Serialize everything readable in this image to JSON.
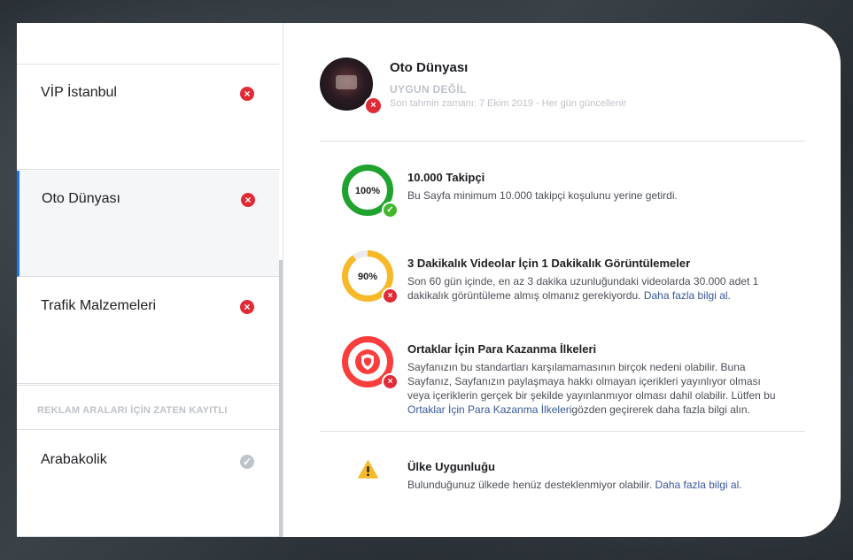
{
  "sidebar": {
    "items": [
      {
        "label": "VİP İstanbul",
        "status": "×"
      },
      {
        "label": "Oto Dünyası",
        "status": "×"
      },
      {
        "label": "Trafik Malzemeleri",
        "status": "×"
      }
    ],
    "section_header": "REKLAM ARALARI İÇİN ZATEN KAYITLI",
    "registered": [
      {
        "label": "Arabakolik",
        "status": "✓"
      }
    ]
  },
  "page": {
    "name": "Oto Dünyası",
    "status": "UYGUN DEĞİL",
    "updated": "Son tahmin zamanı: 7 Ekim 2019 - Her gün güncellenir",
    "badge": "×"
  },
  "criteria": [
    {
      "title": "10.000 Takipçi",
      "desc": "Bu Sayfa minimum 10.000 takipçi koşulunu yerine getirdi.",
      "percent_label": "100%",
      "progress": 1.0,
      "color": "#1fa22e",
      "badge": "✓"
    },
    {
      "title": "3 Dakikalık Videolar İçin 1 Dakikalık Görüntülemeler",
      "desc": "Son 60 gün içinde, en az 3 dakika uzunluğundaki videolarda 30.000 adet 1 dakikalık görüntüleme almış olmanız gerekiyordu.",
      "link": "Daha fazla bilgi al.",
      "percent_label": "90%",
      "progress": 0.9,
      "color": "#f7b928",
      "badge": "×"
    },
    {
      "title": "Ortaklar İçin Para Kazanma İlkeleri",
      "desc_before": "Sayfanızın bu standartları karşılamamasının birçok nedeni olabilir. Buna Sayfanız, Sayfanızın paylaşmaya hakkı olmayan içerikleri yayınlıyor olması veya içeriklerin gerçek bir şekilde yayınlanmıyor olması dahil olabilir. Lütfen bu ",
      "link": "Ortaklar İçin Para Kazanma İlkeleri",
      "desc_after": "gözden geçirerek daha fazla bilgi alın.",
      "color": "#fa3e3e",
      "icon": "shield-icon",
      "badge": "×"
    }
  ],
  "country": {
    "title": "Ülke Uygunluğu",
    "desc": "Bulunduğunuz ülkede henüz desteklenmiyor olabilir.",
    "link": "Daha fazla bilgi al.",
    "icon": "warning-icon",
    "color": "#f7b928"
  }
}
